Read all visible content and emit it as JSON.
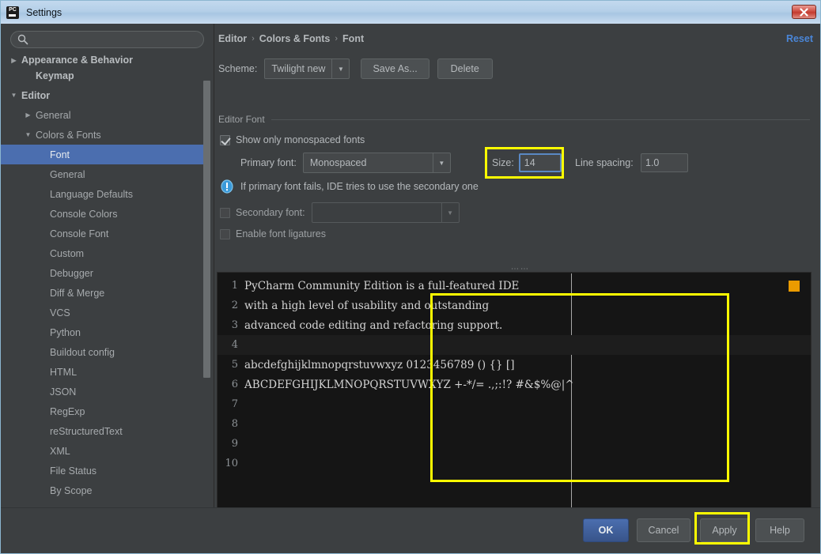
{
  "window": {
    "title": "Settings",
    "app_icon": "pycharm-icon",
    "close_label": "✕"
  },
  "sidebar": {
    "search": {
      "value": "",
      "placeholder": "",
      "icon": "search-icon"
    },
    "items": [
      {
        "label": "Appearance & Behavior",
        "depth": 0,
        "arrow": "collapsed",
        "bold": true,
        "selected": false,
        "clipped": true
      },
      {
        "label": "Keymap",
        "depth": 1,
        "arrow": "none",
        "bold": true,
        "selected": false
      },
      {
        "label": "Editor",
        "depth": 0,
        "arrow": "expanded",
        "bold": true,
        "selected": false
      },
      {
        "label": "General",
        "depth": 1,
        "arrow": "collapsed",
        "bold": false,
        "selected": false
      },
      {
        "label": "Colors & Fonts",
        "depth": 1,
        "arrow": "expanded",
        "bold": false,
        "selected": false
      },
      {
        "label": "Font",
        "depth": 2,
        "arrow": "none",
        "bold": false,
        "selected": true
      },
      {
        "label": "General",
        "depth": 2,
        "arrow": "none",
        "bold": false,
        "selected": false
      },
      {
        "label": "Language Defaults",
        "depth": 2,
        "arrow": "none",
        "bold": false,
        "selected": false
      },
      {
        "label": "Console Colors",
        "depth": 2,
        "arrow": "none",
        "bold": false,
        "selected": false
      },
      {
        "label": "Console Font",
        "depth": 2,
        "arrow": "none",
        "bold": false,
        "selected": false
      },
      {
        "label": "Custom",
        "depth": 2,
        "arrow": "none",
        "bold": false,
        "selected": false
      },
      {
        "label": "Debugger",
        "depth": 2,
        "arrow": "none",
        "bold": false,
        "selected": false
      },
      {
        "label": "Diff & Merge",
        "depth": 2,
        "arrow": "none",
        "bold": false,
        "selected": false
      },
      {
        "label": "VCS",
        "depth": 2,
        "arrow": "none",
        "bold": false,
        "selected": false
      },
      {
        "label": "Python",
        "depth": 2,
        "arrow": "none",
        "bold": false,
        "selected": false
      },
      {
        "label": "Buildout config",
        "depth": 2,
        "arrow": "none",
        "bold": false,
        "selected": false
      },
      {
        "label": "HTML",
        "depth": 2,
        "arrow": "none",
        "bold": false,
        "selected": false
      },
      {
        "label": "JSON",
        "depth": 2,
        "arrow": "none",
        "bold": false,
        "selected": false
      },
      {
        "label": "RegExp",
        "depth": 2,
        "arrow": "none",
        "bold": false,
        "selected": false
      },
      {
        "label": "reStructuredText",
        "depth": 2,
        "arrow": "none",
        "bold": false,
        "selected": false
      },
      {
        "label": "XML",
        "depth": 2,
        "arrow": "none",
        "bold": false,
        "selected": false
      },
      {
        "label": "File Status",
        "depth": 2,
        "arrow": "none",
        "bold": false,
        "selected": false
      },
      {
        "label": "By Scope",
        "depth": 2,
        "arrow": "none",
        "bold": false,
        "selected": false
      }
    ]
  },
  "header": {
    "breadcrumb": [
      "Editor",
      "Colors & Fonts",
      "Font"
    ],
    "separator": "›",
    "reset_label": "Reset"
  },
  "scheme": {
    "label": "Scheme:",
    "value": "Twilight new",
    "save_as_label": "Save As...",
    "delete_label": "Delete"
  },
  "editor_font": {
    "group_title": "Editor Font",
    "show_monospaced_label": "Show only monospaced fonts",
    "show_monospaced_checked": true,
    "primary_font_label": "Primary font:",
    "primary_font_value": "Monospaced",
    "size_label": "Size:",
    "size_value": "14",
    "line_spacing_label": "Line spacing:",
    "line_spacing_value": "1.0",
    "info_text": "If primary font fails, IDE tries to use the secondary one",
    "info_icon": "info-icon",
    "secondary_font_label": "Secondary font:",
    "secondary_font_value": "",
    "secondary_font_checked": false,
    "ligatures_label": "Enable font ligatures",
    "ligatures_checked": false
  },
  "preview": {
    "lines": [
      {
        "num": "1",
        "text": "PyCharm Community Edition is a full-featured IDE"
      },
      {
        "num": "2",
        "text": "with a high level of usability and outstanding"
      },
      {
        "num": "3",
        "text": "advanced code editing and refactoring support."
      },
      {
        "num": "4",
        "text": ""
      },
      {
        "num": "5",
        "text": "abcdefghijklmnopqrstuvwxyz 0123456789 () {} []"
      },
      {
        "num": "6",
        "text": "ABCDEFGHIJKLMNOPQRSTUVWXYZ +-*/= .,;:!? #&$%@|^"
      },
      {
        "num": "7",
        "text": ""
      },
      {
        "num": "8",
        "text": ""
      },
      {
        "num": "9",
        "text": ""
      },
      {
        "num": "10",
        "text": ""
      }
    ],
    "caret_line_index": 3,
    "marker_color": "#eb9b00"
  },
  "footer": {
    "ok_label": "OK",
    "cancel_label": "Cancel",
    "apply_label": "Apply",
    "help_label": "Help"
  },
  "highlights": {
    "accent_color": "#ffff00",
    "targets": [
      "size-field",
      "preview-area",
      "apply-button"
    ]
  }
}
